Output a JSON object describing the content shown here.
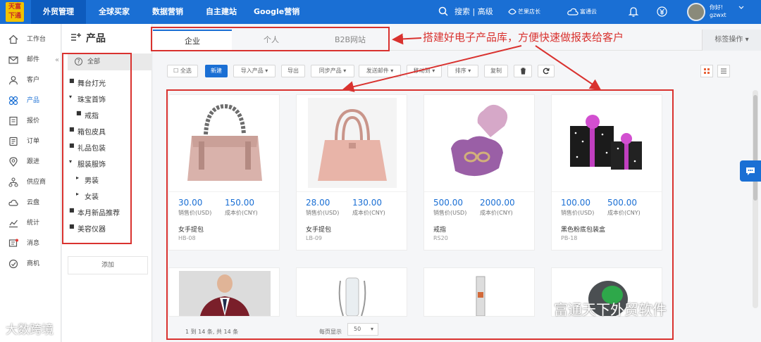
{
  "topbar": {
    "logo_text": "天富下通",
    "nav": [
      "外贸管理",
      "全球买家",
      "数据营销",
      "自主建站",
      "Google营销"
    ],
    "search": "搜索 | 高级",
    "mango": "芒果店长",
    "cloud": "富通云",
    "greeting": "你好!",
    "username": "gzwxt"
  },
  "leftnav": [
    "工作台",
    "邮件",
    "客户",
    "产品",
    "报价",
    "订单",
    "跟进",
    "供应商",
    "云盘",
    "统计",
    "消息",
    "商机"
  ],
  "catpanel": {
    "title": "产品",
    "all": "全部",
    "items": [
      "舞台灯光",
      "珠宝首饰",
      "戒指",
      "箱包皮具",
      "礼品包装",
      "服装服饰",
      "男装",
      "女装",
      "本月新品推荐",
      "美容仪器"
    ],
    "add": "添加"
  },
  "tabs": [
    "企业",
    "个人",
    "B2B网站"
  ],
  "tag_ops": "标签操作",
  "toolbar": {
    "select_all": "全选",
    "new": "新建",
    "import": "导入产品",
    "export": "导出",
    "sync": "同步产品",
    "send_mail": "发送邮件",
    "move_to": "移动到",
    "sort": "排序",
    "copy": "复制"
  },
  "products": [
    {
      "sell": "30.00",
      "cost": "150.00",
      "sell_label": "销售价(USD)",
      "cost_label": "成本价(CNY)",
      "name": "女手提包",
      "code": "HB-08"
    },
    {
      "sell": "28.00",
      "cost": "130.00",
      "sell_label": "销售价(USD)",
      "cost_label": "成本价(CNY)",
      "name": "女手提包",
      "code": "LB-09"
    },
    {
      "sell": "500.00",
      "cost": "2000.00",
      "sell_label": "销售价(USD)",
      "cost_label": "成本价(CNY)",
      "name": "戒指",
      "code": "RS20"
    },
    {
      "sell": "100.00",
      "cost": "500.00",
      "sell_label": "销售价(USD)",
      "cost_label": "成本价(CNY)",
      "name": "黑色粉底包装盒",
      "code": "PB-18"
    }
  ],
  "pager": {
    "summary": "1 到 14 条, 共 14 条",
    "per_page_label": "每页显示",
    "per_page": "50"
  },
  "annotation": "搭建好电子产品库，方便快速做报表给客户",
  "watermarks": {
    "left": "大数跨境",
    "right": "富通天下外贸软件"
  },
  "colors": {
    "brand": "#1a6fd4",
    "annotation": "#d9322f",
    "price": "#1a6fd4"
  }
}
